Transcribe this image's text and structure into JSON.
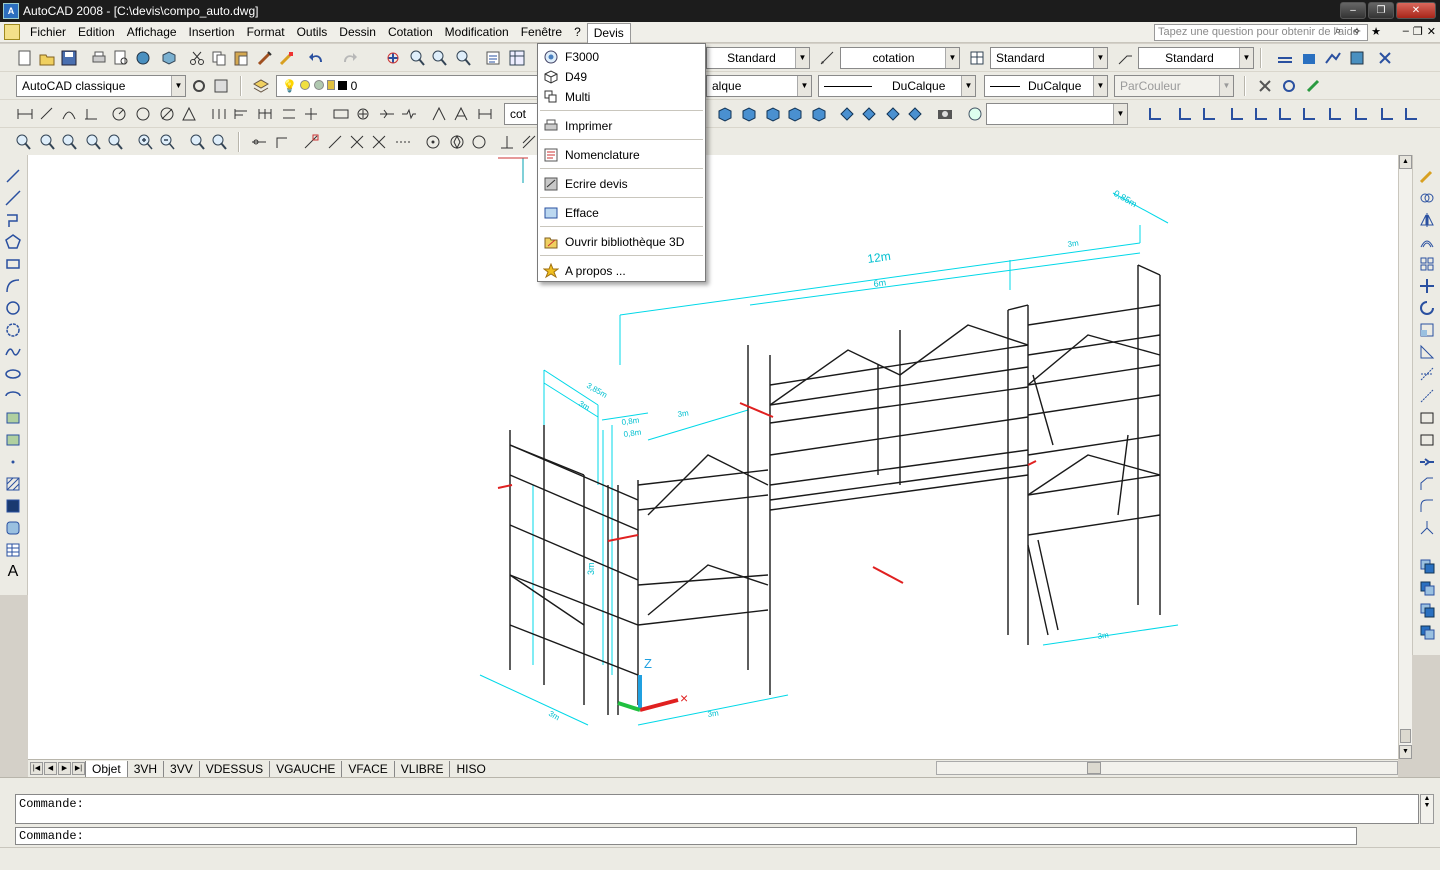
{
  "window": {
    "title": "AutoCAD 2008 - [C:\\devis\\compo_auto.dwg]",
    "app_icon_label": "A",
    "min": "–",
    "max": "❐",
    "close": "✕"
  },
  "menubar": {
    "items": [
      "Fichier",
      "Edition",
      "Affichage",
      "Insertion",
      "Format",
      "Outils",
      "Dessin",
      "Cotation",
      "Modification",
      "Fenêtre",
      "?",
      "Devis"
    ],
    "help_placeholder": "Tapez une question pour obtenir de l'aide",
    "mdi_min": "–",
    "mdi_restore": "❐",
    "mdi_close": "✕"
  },
  "devis_menu": {
    "items": [
      {
        "label": "F3000",
        "icon": "circle-target-icon"
      },
      {
        "label": "D49",
        "icon": "cube-icon"
      },
      {
        "label": "Multi",
        "icon": "multi-icon"
      },
      {
        "label": "Imprimer",
        "icon": "printer-icon"
      },
      {
        "label": "Nomenclature",
        "icon": "nomenclature-icon"
      },
      {
        "label": "Ecrire devis",
        "icon": "write-devis-icon"
      },
      {
        "label": "Efface",
        "icon": "erase-icon"
      },
      {
        "label": "Ouvrir bibliothèque 3D",
        "icon": "library-3d-icon"
      },
      {
        "label": "A propos ...",
        "icon": "about-star-icon"
      }
    ]
  },
  "toolbar2": {
    "text_style": "Standard",
    "dim_style": "cotation",
    "table_style": "Standard",
    "mleader_style": "Standard"
  },
  "toolbar3": {
    "workspace": "AutoCAD classique",
    "layer": "0",
    "layer_partial": "alque",
    "linetype": "DuCalque",
    "lineweight": "DuCalque",
    "plotstyle": "ParCouleur"
  },
  "toolbar4": {
    "dim_partial": "cot",
    "view_combo": ""
  },
  "tabs": [
    "Objet",
    "3VH",
    "3VV",
    "VDESSUS",
    "VGAUCHE",
    "VFACE",
    "VLIBRE",
    "HISO"
  ],
  "active_tab": "Objet",
  "command": {
    "history_line": "Commande:",
    "prompt": "Commande:"
  },
  "drawing": {
    "dimensions": [
      "12m",
      "6m",
      "3m",
      "3m",
      "3m",
      "0,85m",
      "3,85m",
      "3m",
      "0,8m",
      "0,8m",
      "3m",
      "3m",
      "3m",
      "3m"
    ],
    "ucs_z": "Z",
    "ucs_x": "×",
    "colors": {
      "dim": "#00d8e8",
      "structure": "#1a1a1a",
      "red": "#e02020"
    }
  }
}
